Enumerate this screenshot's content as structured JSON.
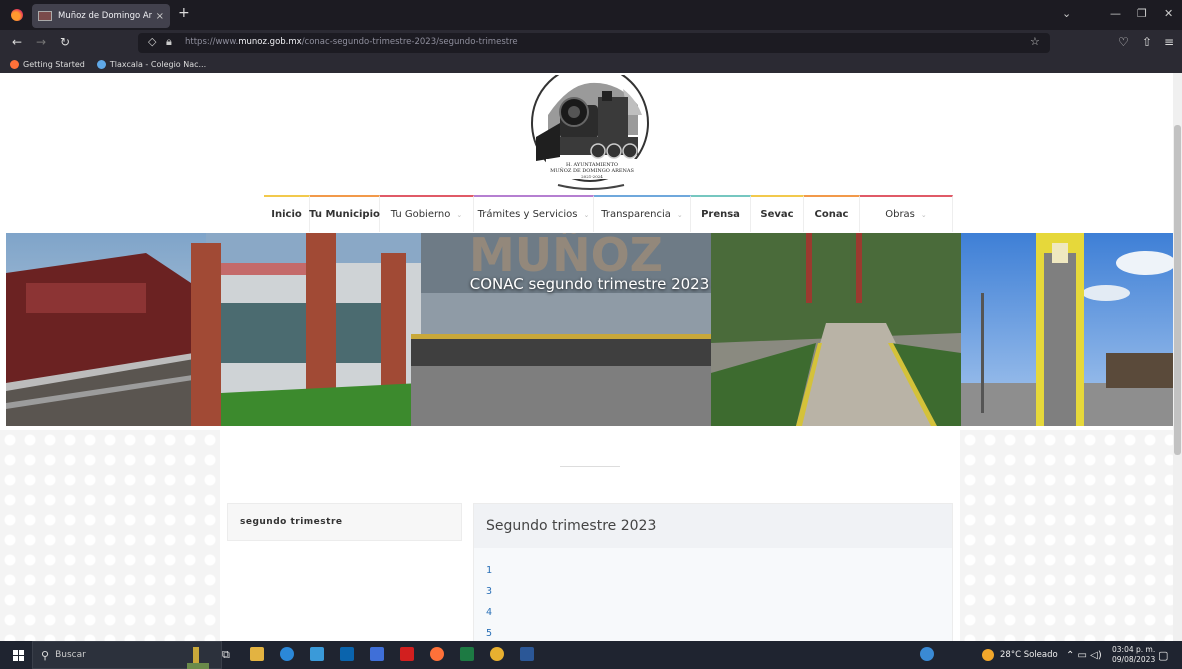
{
  "browser": {
    "tab_title": "Muñoz de Domingo Arenas",
    "tab_close": "×",
    "new_tab": "+",
    "url_prefix": "https://www.",
    "url_domain": "munoz.gob.mx",
    "url_path": "/conac-segundo-trimestre-2023/segundo-trimestre",
    "bookmarks": [
      {
        "label": "Getting Started",
        "color": "#ff7139"
      },
      {
        "label": "Tlaxcala - Colegio Nac...",
        "color": "#5fa8e8"
      }
    ]
  },
  "site": {
    "logo": {
      "line1": "H. AYUNTAMIENTO",
      "line2": "MUÑOZ DE DOMINGO ARENAS",
      "line3": "2021-2024"
    },
    "menu": [
      {
        "label": "Inicio",
        "bold": true,
        "dropdown": false,
        "color": "#f2c94c",
        "width": 46
      },
      {
        "label": "Tu Municipio",
        "bold": true,
        "dropdown": false,
        "color": "#f2994a",
        "width": 70
      },
      {
        "label": "Tu Gobierno",
        "bold": false,
        "dropdown": true,
        "color": "#e05a67",
        "width": 94
      },
      {
        "label": "Trámites y Servicios",
        "bold": false,
        "dropdown": true,
        "color": "#b57fd1",
        "width": 120
      },
      {
        "label": "Transparencia",
        "bold": false,
        "dropdown": true,
        "color": "#6fa8dc",
        "width": 97
      },
      {
        "label": "Prensa",
        "bold": true,
        "dropdown": false,
        "color": "#76c7c0",
        "width": 60
      },
      {
        "label": "Sevac",
        "bold": true,
        "dropdown": false,
        "color": "#f2c94c",
        "width": 53
      },
      {
        "label": "Conac",
        "bold": true,
        "dropdown": false,
        "color": "#f2994a",
        "width": 56
      },
      {
        "label": "Obras",
        "bold": false,
        "dropdown": true,
        "color": "#e05a67",
        "width": 93
      }
    ],
    "hero_title": "CONAC segundo trimestre 2023",
    "hero_sign": "MUÑOZ",
    "sidebar_label": "segundo trimestre",
    "panel_title": "Segundo trimestre 2023",
    "panel_links": [
      "1",
      "3",
      "4",
      "5"
    ]
  },
  "taskbar": {
    "search_placeholder": "Buscar",
    "weather": "28°C Soleado",
    "time": "03:04 p. m.",
    "date": "09/08/2023"
  }
}
